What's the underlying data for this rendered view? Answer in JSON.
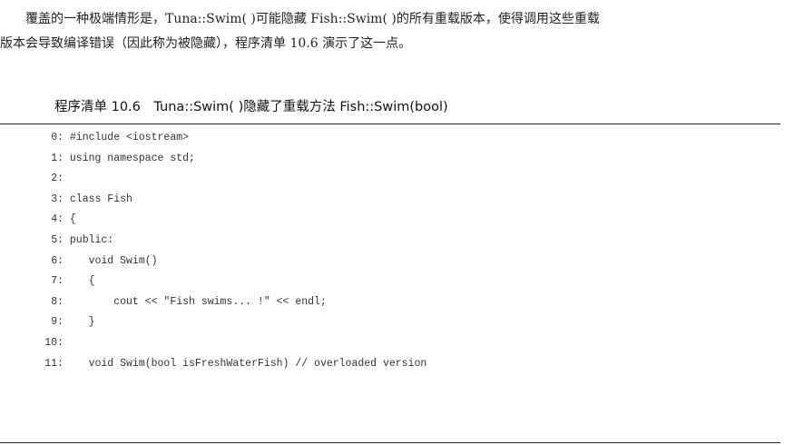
{
  "paragraph": {
    "line1": "覆盖的一种极端情形是，Tuna::Swim( )可能隐藏 Fish::Swim( )的所有重载版本，使得调用这些重载",
    "line2": "版本会导致编译错误（因此称为被隐藏），程序清单 10.6 演示了这一点。"
  },
  "listing": {
    "caption": "程序清单 10.6　Tuna::Swim( )隐藏了重载方法 Fish::Swim(bool)",
    "lines": [
      {
        "n": "0:",
        "code": " #include <iostream>"
      },
      {
        "n": "1:",
        "code": " using namespace std;"
      },
      {
        "n": "2:",
        "code": ""
      },
      {
        "n": "3:",
        "code": " class Fish"
      },
      {
        "n": "4:",
        "code": " {"
      },
      {
        "n": "5:",
        "code": " public:"
      },
      {
        "n": "6:",
        "code": "    void Swim()"
      },
      {
        "n": "7:",
        "code": "    {"
      },
      {
        "n": "8:",
        "code": "        cout << \"Fish swims... !\" << endl;"
      },
      {
        "n": "9:",
        "code": "    }"
      },
      {
        "n": "10:",
        "code": ""
      },
      {
        "n": "11:",
        "code": "    void Swim(bool isFreshWaterFish) // overloaded version"
      }
    ]
  }
}
